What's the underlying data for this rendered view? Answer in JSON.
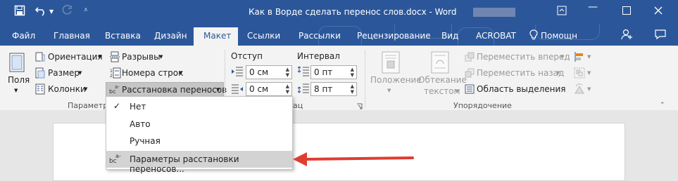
{
  "window": {
    "title": "Как в Ворде сделать перенос слов.docx - Word"
  },
  "tabs": [
    "Файл",
    "Главная",
    "Вставка",
    "Дизайн",
    "Макет",
    "Ссылки",
    "Рассылки",
    "Рецензирование",
    "Вид",
    "ACROBAT",
    "Помощн"
  ],
  "ribbon": {
    "page_setup": {
      "fields": "Поля",
      "orientation": "Ориентация",
      "size": "Размер",
      "columns": "Колонки",
      "breaks": "Разрывы",
      "line_numbers": "Номера строк",
      "hyphenation": "Расстановка переносов",
      "group_label": "Параметры"
    },
    "paragraph": {
      "indent_label": "Отступ",
      "spacing_label": "Интервал",
      "indent_left": "0 см",
      "indent_right": "0 см",
      "spacing_before": "0 пт",
      "spacing_after": "8 пт",
      "group_label_tail": "ац"
    },
    "arrange": {
      "position": "Положение",
      "wrap_text_1": "Обтекание",
      "wrap_text_2": "текстом",
      "bring_forward": "Переместить вперед",
      "send_backward": "Переместить назад",
      "selection_pane": "Область выделения",
      "group_label": "Упорядочение"
    }
  },
  "hyphenation_menu": {
    "items": [
      "Нет",
      "Авто",
      "Ручная"
    ],
    "options_item": "Параметры расстановки переносов..."
  },
  "colors": {
    "accent": "#2b579a",
    "arrow": "#e03c31"
  }
}
